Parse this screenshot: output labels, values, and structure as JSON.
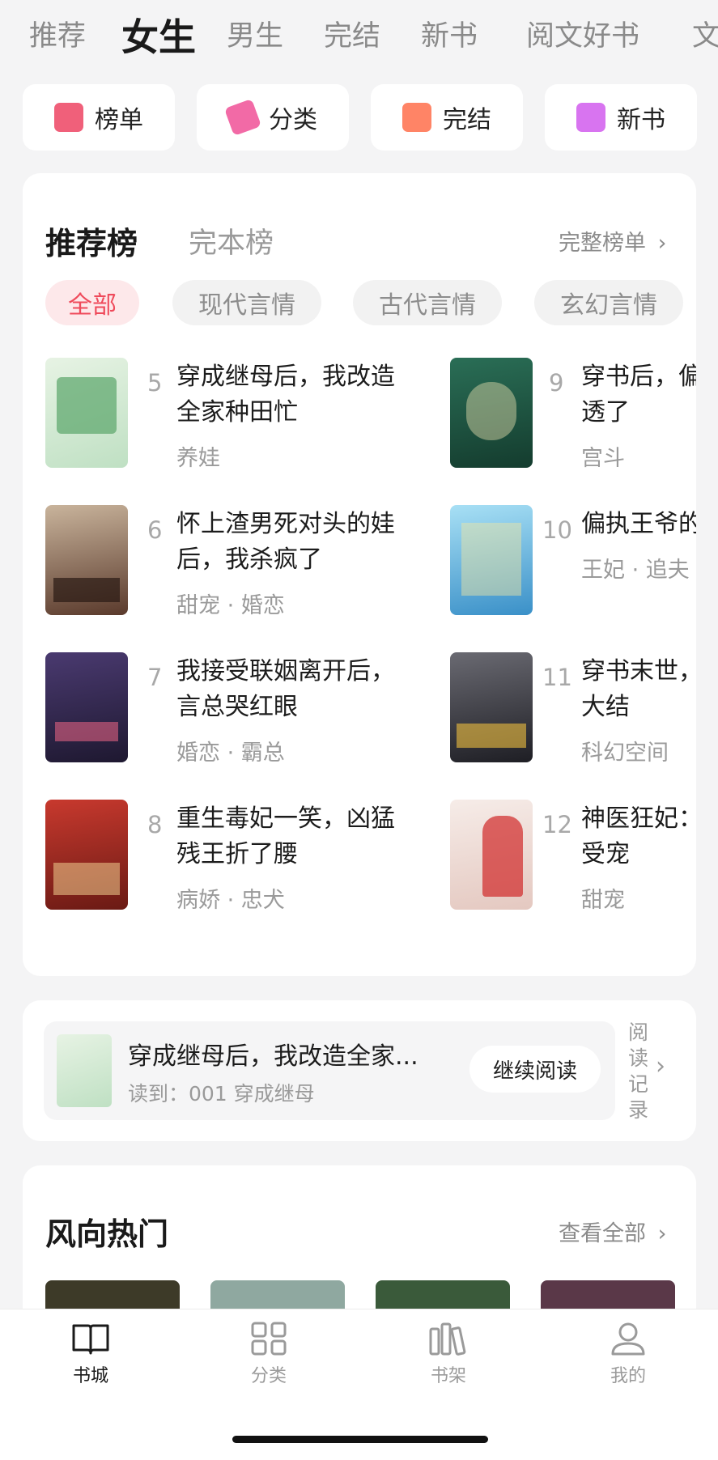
{
  "top_tabs": [
    "推荐",
    "女生",
    "男生",
    "完结",
    "新书",
    "阅文好书",
    "文"
  ],
  "active_tab": "女生",
  "quick_links": [
    {
      "label": "榜单",
      "icon": "ranking-icon",
      "color": "#f0607a"
    },
    {
      "label": "分类",
      "icon": "tag-icon",
      "color": "#f26aa6"
    },
    {
      "label": "完结",
      "icon": "book-icon",
      "color": "#ff8466"
    },
    {
      "label": "新书",
      "icon": "new-book-icon",
      "color": "#d874f0"
    }
  ],
  "ranking": {
    "title_active": "推荐榜",
    "title_inactive": "完本榜",
    "more_label": "完整榜单",
    "chips": [
      "全部",
      "现代言情",
      "古代言情",
      "玄幻言情"
    ],
    "books": [
      {
        "rank": "5",
        "title": "穿成继母后，我改造全家种田忙",
        "tags": "养娃",
        "cover_color": "#cfe7d0",
        "cover_accent": "#5aa56a"
      },
      {
        "rank": "6",
        "title": "怀上渣男死对头的娃后，我杀疯了",
        "tags": "甜宠 · 婚恋",
        "cover_color": "#6b4a3a",
        "cover_accent": "#e8d4b8"
      },
      {
        "rank": "7",
        "title": "我接受联姻离开后，言总哭红眼",
        "tags": "婚恋 · 霸总",
        "cover_color": "#3a2a55",
        "cover_accent": "#e06080"
      },
      {
        "rank": "8",
        "title": "重生毒妃一笑，凶猛残王折了腰",
        "tags": "病娇 · 忠犬",
        "cover_color": "#9b2a22",
        "cover_accent": "#f0d090"
      },
      {
        "rank": "9",
        "title": "穿书后，偏偏又剧透了",
        "tags": "宫斗",
        "cover_color": "#1e5a45",
        "cover_accent": "#e8e0b0"
      },
      {
        "rank": "10",
        "title": "偏执王爷的",
        "tags": "王妃 · 追夫",
        "cover_color": "#5fb8e0",
        "cover_accent": "#f5e6a0"
      },
      {
        "rank": "11",
        "title": "穿书末世，货苟到大结",
        "tags": "科幻空间",
        "cover_color": "#2a2a30",
        "cover_accent": "#f0c040"
      },
      {
        "rank": "12",
        "title": "神医狂妃：爷乖乖受宠",
        "tags": "甜宠",
        "cover_color": "#f4e8e4",
        "cover_accent": "#d02828"
      }
    ]
  },
  "history": {
    "title": "穿成继母后，我改造全家...",
    "progress": "读到：001 穿成继母",
    "button": "继续阅读",
    "side_label": "阅读记录",
    "cover_color": "#cfe7d0"
  },
  "hot": {
    "title": "风向热门",
    "more_label": "查看全部",
    "covers": [
      "#3d3a28",
      "#8fa8a0",
      "#3a5a3a",
      "#5a3848"
    ]
  },
  "bottom_nav": [
    {
      "label": "书城",
      "icon": "open-book-icon",
      "active": true
    },
    {
      "label": "分类",
      "icon": "grid-icon",
      "active": false
    },
    {
      "label": "书架",
      "icon": "bookshelf-icon",
      "active": false
    },
    {
      "label": "我的",
      "icon": "user-icon",
      "active": false
    }
  ]
}
